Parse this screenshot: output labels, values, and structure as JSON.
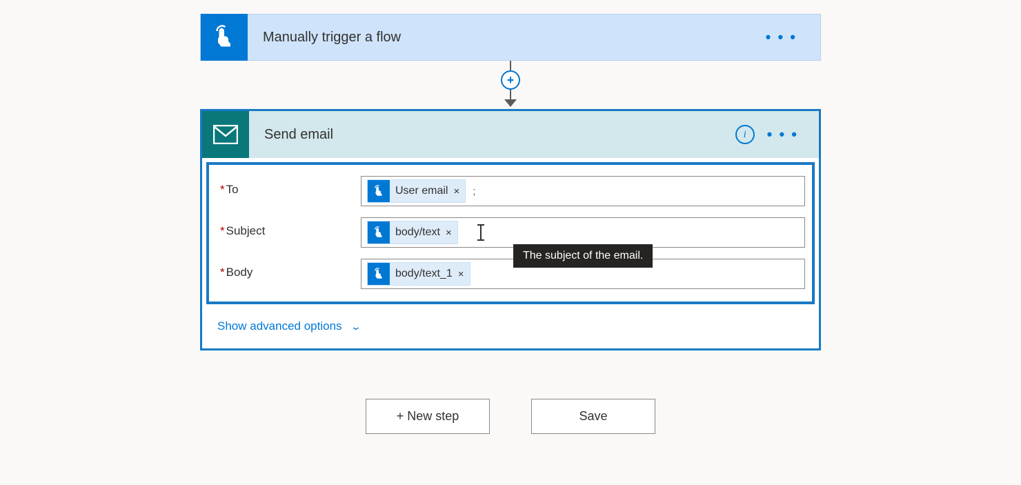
{
  "trigger": {
    "title": "Manually trigger a flow"
  },
  "action": {
    "title": "Send email",
    "advanced_label": "Show advanced options",
    "fields": {
      "to": {
        "label": "To",
        "token_label": "User email",
        "separator": ";"
      },
      "subject": {
        "label": "Subject",
        "token_label": "body/text",
        "tooltip": "The subject of the email."
      },
      "body": {
        "label": "Body",
        "token_label": "body/text_1"
      }
    }
  },
  "buttons": {
    "new_step": "+ New step",
    "save": "Save"
  },
  "symbols": {
    "plus": "+",
    "info": "i",
    "remove": "×",
    "chevron": "⌄",
    "dots": "• • •"
  }
}
